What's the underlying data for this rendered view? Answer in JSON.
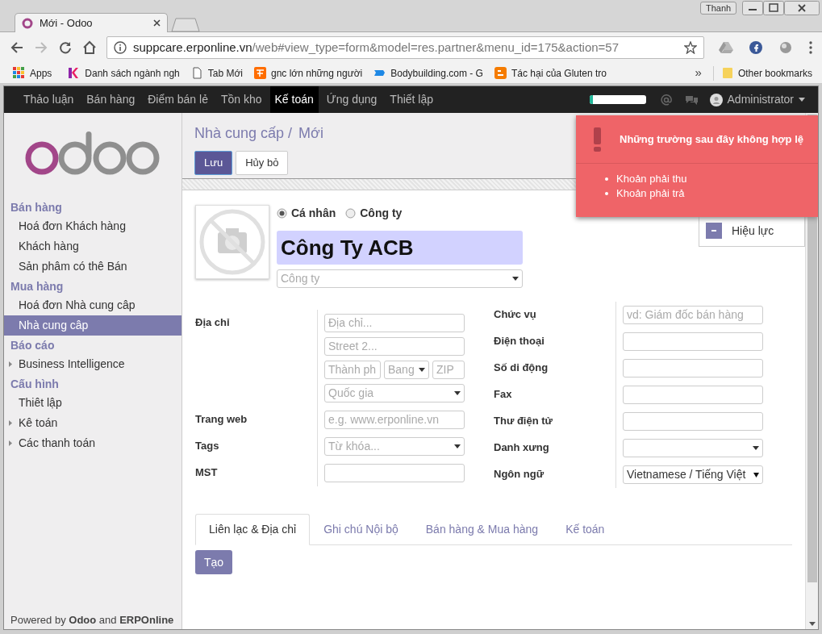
{
  "browser": {
    "user": "Thanh",
    "tabs": [
      {
        "title": "Mới - Odoo",
        "selected": true
      }
    ],
    "url_host": "suppcare.erponline.vn",
    "url_path": "/web#view_type=form&model=res.partner&menu_id=175&action=57",
    "bookmarks": [
      {
        "label": "Apps",
        "kind": "apps"
      },
      {
        "label": "Danh sách ngành ngh",
        "kind": "kp"
      },
      {
        "label": "Tab Mới",
        "kind": "page"
      },
      {
        "label": "gnc lớn những người",
        "kind": "taobao"
      },
      {
        "label": "Bodybuilding.com - G",
        "kind": "bb"
      },
      {
        "label": "Tác hại của Gluten tro",
        "kind": "blogger"
      }
    ],
    "overflow": "»",
    "other_bookmarks": "Other bookmarks"
  },
  "topnav": {
    "items": [
      {
        "label": "Thảo luận",
        "selected": false
      },
      {
        "label": "Bán hàng",
        "selected": false
      },
      {
        "label": "Điểm bán lẻ",
        "selected": false
      },
      {
        "label": "Tồn kho",
        "selected": false
      },
      {
        "label": "Kế toán",
        "selected": true
      },
      {
        "label": "Ứng dụng",
        "selected": false
      },
      {
        "label": "Thiết lập",
        "selected": false
      }
    ],
    "progress": {
      "level": 0.06
    },
    "user": "Administrator"
  },
  "sidebar": {
    "sections": [
      {
        "title": "Bán hàng",
        "items": [
          {
            "label": "Hoá đơn Khách hàng",
            "selected": false,
            "expandable": false
          },
          {
            "label": "Khách hàng",
            "selected": false,
            "expandable": false
          },
          {
            "label": "Sản phâm có thê Bán",
            "selected": false,
            "expandable": false
          }
        ]
      },
      {
        "title": "Mua hàng",
        "items": [
          {
            "label": "Hoá đơn Nhà cung câp",
            "selected": false,
            "expandable": false
          },
          {
            "label": "Nhà cung câp",
            "selected": true,
            "expandable": false
          }
        ]
      },
      {
        "title": "Báo cáo",
        "items": [
          {
            "label": "Business Intelligence",
            "selected": false,
            "expandable": true
          }
        ]
      },
      {
        "title": "Cấu hình",
        "items": [
          {
            "label": "Thiêt lập",
            "selected": false,
            "expandable": false
          },
          {
            "label": "Kê toán",
            "selected": false,
            "expandable": true
          },
          {
            "label": "Các thanh toán",
            "selected": false,
            "expandable": true
          }
        ]
      }
    ],
    "footer": "Powered by **Odoo** and **ERPOnline**"
  },
  "breadcrumb": {
    "parent": "Nhà cung cấp /",
    "current": "Mới"
  },
  "buttons": [
    {
      "label": "Lưu",
      "kind": "primary"
    },
    {
      "label": "Hủy bỏ",
      "kind": "default"
    }
  ],
  "form": {
    "partner_type": [
      {
        "label": "Cá nhân",
        "selected": true
      },
      {
        "label": "Công ty",
        "selected": false
      }
    ],
    "name": "Công Ty ACB",
    "company": {
      "kind": "select",
      "placeholder": "Công ty"
    },
    "status_button": "Hiệu lực",
    "left_fields": [
      {
        "label": "Địa chỉ",
        "rows": [
          [
            {
              "kind": "text",
              "placeholder": "Địa chỉ..."
            }
          ],
          [
            {
              "kind": "text",
              "placeholder": "Street 2..."
            }
          ],
          [
            {
              "kind": "text",
              "placeholder": "Thành ph"
            },
            {
              "kind": "select",
              "placeholder": "Bang"
            },
            {
              "kind": "text",
              "placeholder": "ZIP"
            }
          ],
          [
            {
              "kind": "select",
              "placeholder": "Quốc gia"
            }
          ]
        ]
      },
      {
        "label": "Trang web",
        "rows": [
          [
            {
              "kind": "text",
              "placeholder": "e.g. www.erponline.vn"
            }
          ]
        ]
      },
      {
        "label": "Tags",
        "rows": [
          [
            {
              "kind": "select",
              "placeholder": "Từ khóa..."
            }
          ]
        ]
      },
      {
        "label": "MST",
        "rows": [
          [
            {
              "kind": "text"
            }
          ]
        ]
      }
    ],
    "right_fields": [
      {
        "label": "Chức vụ",
        "rows": [
          [
            {
              "kind": "text",
              "placeholder": "vd: Giám đốc bán hàng"
            }
          ]
        ]
      },
      {
        "label": "Điện thoại",
        "rows": [
          [
            {
              "kind": "text"
            }
          ]
        ]
      },
      {
        "label": "Số di động",
        "rows": [
          [
            {
              "kind": "text"
            }
          ]
        ]
      },
      {
        "label": "Fax",
        "rows": [
          [
            {
              "kind": "text"
            }
          ]
        ]
      },
      {
        "label": "Thư điện tử",
        "rows": [
          [
            {
              "kind": "text"
            }
          ]
        ]
      },
      {
        "label": "Danh xưng",
        "rows": [
          [
            {
              "kind": "select"
            }
          ]
        ]
      },
      {
        "label": "Ngôn ngữ",
        "rows": [
          [
            {
              "kind": "native_select",
              "value": "Vietnamese / Tiếng Việt"
            }
          ]
        ]
      }
    ]
  },
  "notebook_tabs": [
    {
      "label": "Liên lạc & Địa chỉ",
      "selected": true
    },
    {
      "label": "Ghi chú Nội bộ",
      "selected": false
    },
    {
      "label": "Bán hàng & Mua hàng",
      "selected": false
    },
    {
      "label": "Kế toán",
      "selected": false
    }
  ],
  "create_button": "Tạo",
  "notification": {
    "title": "Những trường sau đây không hợp lệ",
    "items": [
      "Khoản phải thu",
      "Khoản phải trả"
    ]
  }
}
